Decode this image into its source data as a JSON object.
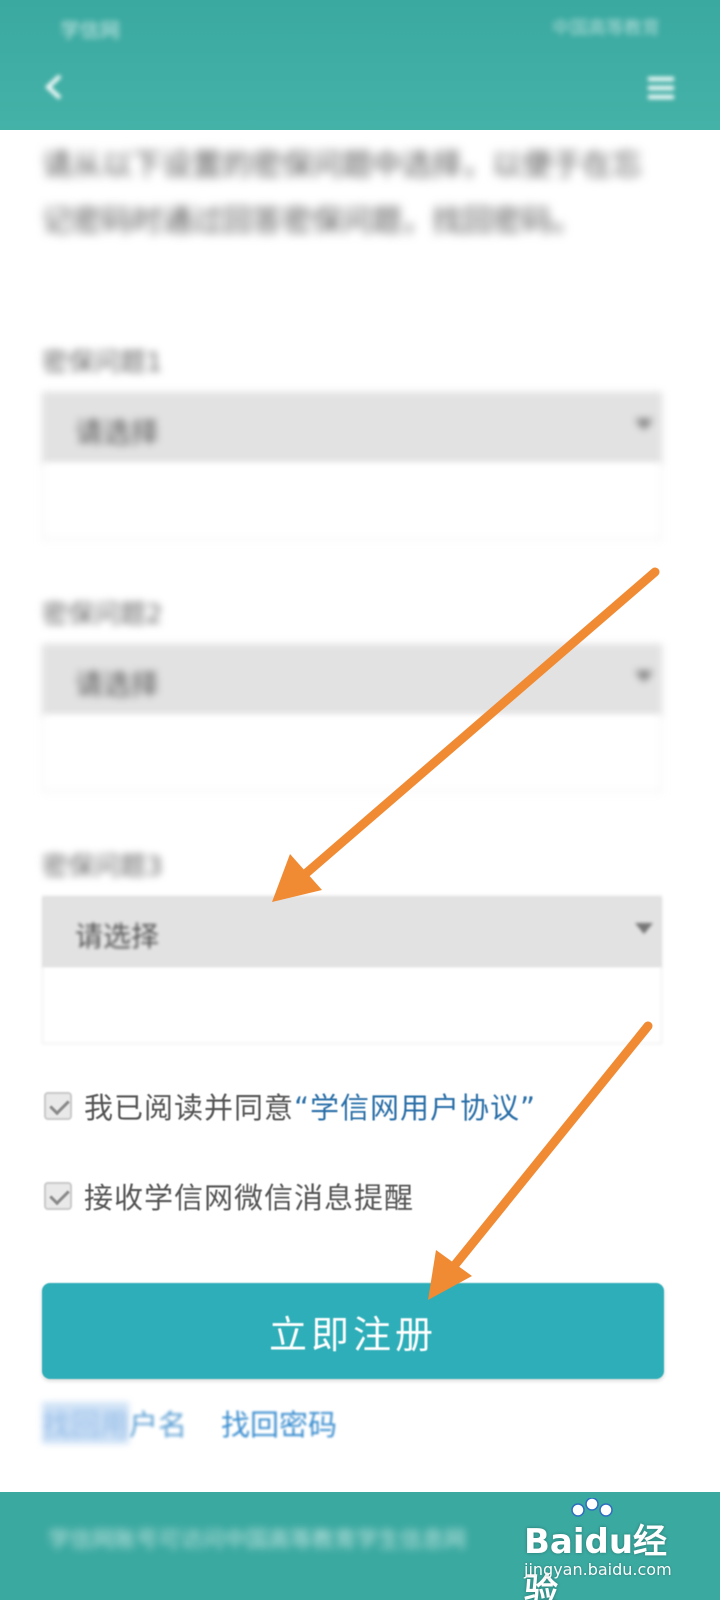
{
  "header": {
    "status_left": "学信网",
    "status_right": "中国高等教育"
  },
  "intro": {
    "text": "请从以下设置的密保问题中选择，以便于在忘记密码时通过回答密保问题，找回密码。"
  },
  "security_questions": [
    {
      "label": "密保问题1",
      "placeholder": "请选择"
    },
    {
      "label": "密保问题2",
      "placeholder": "请选择"
    },
    {
      "label": "密保问题3",
      "placeholder": "请选择"
    }
  ],
  "agreements": {
    "agree_prefix": "我已阅读并同意",
    "agree_link": "“学信网用户协议”",
    "wechat_notice": "接收学信网微信消息提醒"
  },
  "actions": {
    "register_label": "立即注册",
    "find_username_prefix": "找回用",
    "find_username_suffix": "户名",
    "find_password_label": "找回密码"
  },
  "footer": {
    "text": "学信网账号可访问中国高等教育学生信息网"
  },
  "watermark": {
    "brand": "Baidu经验",
    "sub": "jingyan.baidu.com"
  },
  "colors": {
    "header": "#3aa9a0",
    "button": "#2eaeb8",
    "arrow": "#f08a33",
    "link": "#2a6fa8"
  }
}
